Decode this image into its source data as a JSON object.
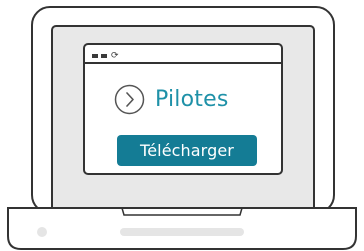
{
  "driver": {
    "label": "Pilotes"
  },
  "download": {
    "label": "Télécharger"
  },
  "browser": {
    "reload_glyph": "⟳"
  },
  "icons": {
    "chevron": "chevron-right-icon",
    "reload": "reload-icon"
  },
  "colors": {
    "accent": "#1f91a8",
    "button": "#147c95",
    "outline": "#333333",
    "screen_bg": "#e8e8e8",
    "base_fill": "#ffffff"
  }
}
